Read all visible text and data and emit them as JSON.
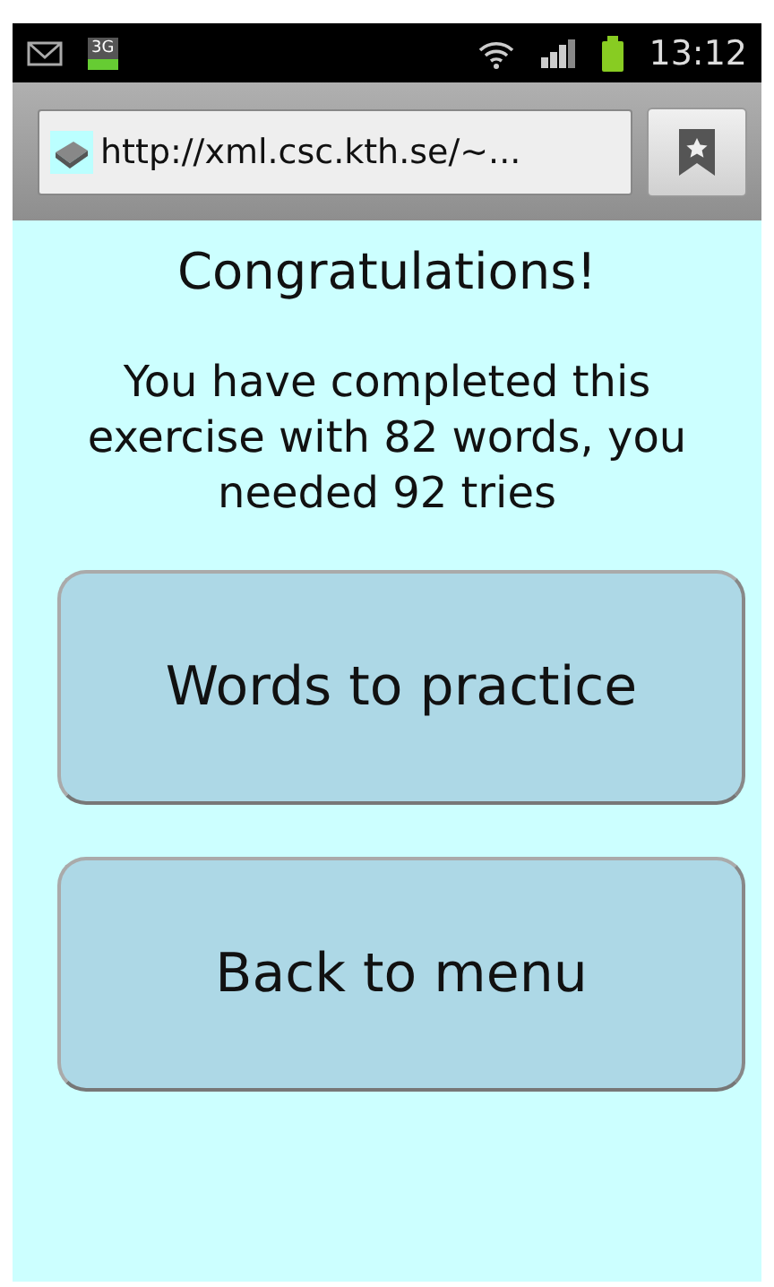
{
  "status_bar": {
    "time": "13:12",
    "network": "3G"
  },
  "address_bar": {
    "url": "http://xml.csc.kth.se/~..."
  },
  "heading": "Congratulations!",
  "message": "You have completed this exercise with 82 words, you needed 92 tries",
  "buttons": [
    "Words to practice",
    "Back to menu"
  ]
}
